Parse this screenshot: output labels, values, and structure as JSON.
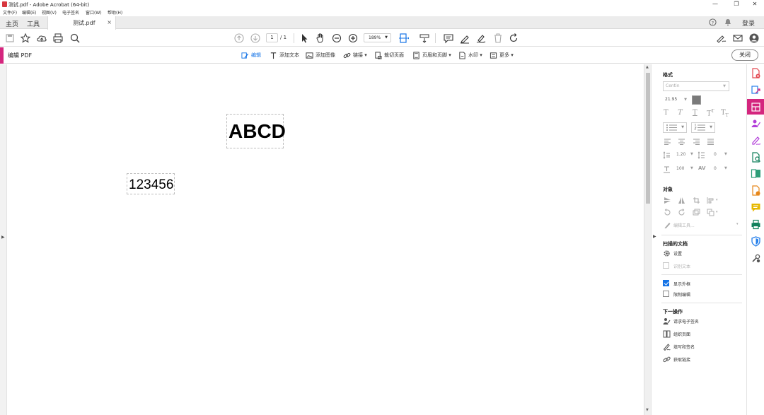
{
  "window": {
    "title": "测试.pdf - Adobe Acrobat (64-bit)",
    "controls": [
      "—",
      "❐",
      "✕"
    ]
  },
  "menubar": [
    "文件(F)",
    "编辑(E)",
    "视图(V)",
    "电子签名",
    "窗口(W)",
    "帮助(H)"
  ],
  "tabs": {
    "home": "主页",
    "tools": "工具",
    "document": "测试.pdf",
    "close": "×",
    "login": "登录"
  },
  "toolbar": {
    "page_current": "1",
    "page_total": "/ 1",
    "zoom": "189%"
  },
  "editbar": {
    "mode_label": "编辑 PDF",
    "tools": [
      "编辑",
      "添加文本",
      "添加图像",
      "链接 ▾",
      "裁切页面",
      "页眉和页脚 ▾",
      "水印 ▾",
      "更多 ▾"
    ],
    "close_label": "关闭"
  },
  "document": {
    "text1": "ABCD",
    "text2": "123456"
  },
  "panel": {
    "format_heading": "格式",
    "font_name": "Centin",
    "font_size": "21.95",
    "line_spacing": "1.20",
    "para_spacing": "0",
    "horiz_scale": "100",
    "char_spacing": "0",
    "objects_heading": "对象",
    "edit_tool": "编辑工具...",
    "scanned_heading": "扫描的文档",
    "settings": "设置",
    "recognize_text": "识别文本",
    "show_bbox": "显示外框",
    "restrict_edit": "限制编辑",
    "next_heading": "下一操作",
    "next_items": [
      "请求电子签名",
      "组织页面",
      "填写和签名",
      "获取链接"
    ]
  },
  "colors": {
    "accent": "#d4267e",
    "active_blue": "#1473e6",
    "swatch": "#7a7a7a"
  }
}
